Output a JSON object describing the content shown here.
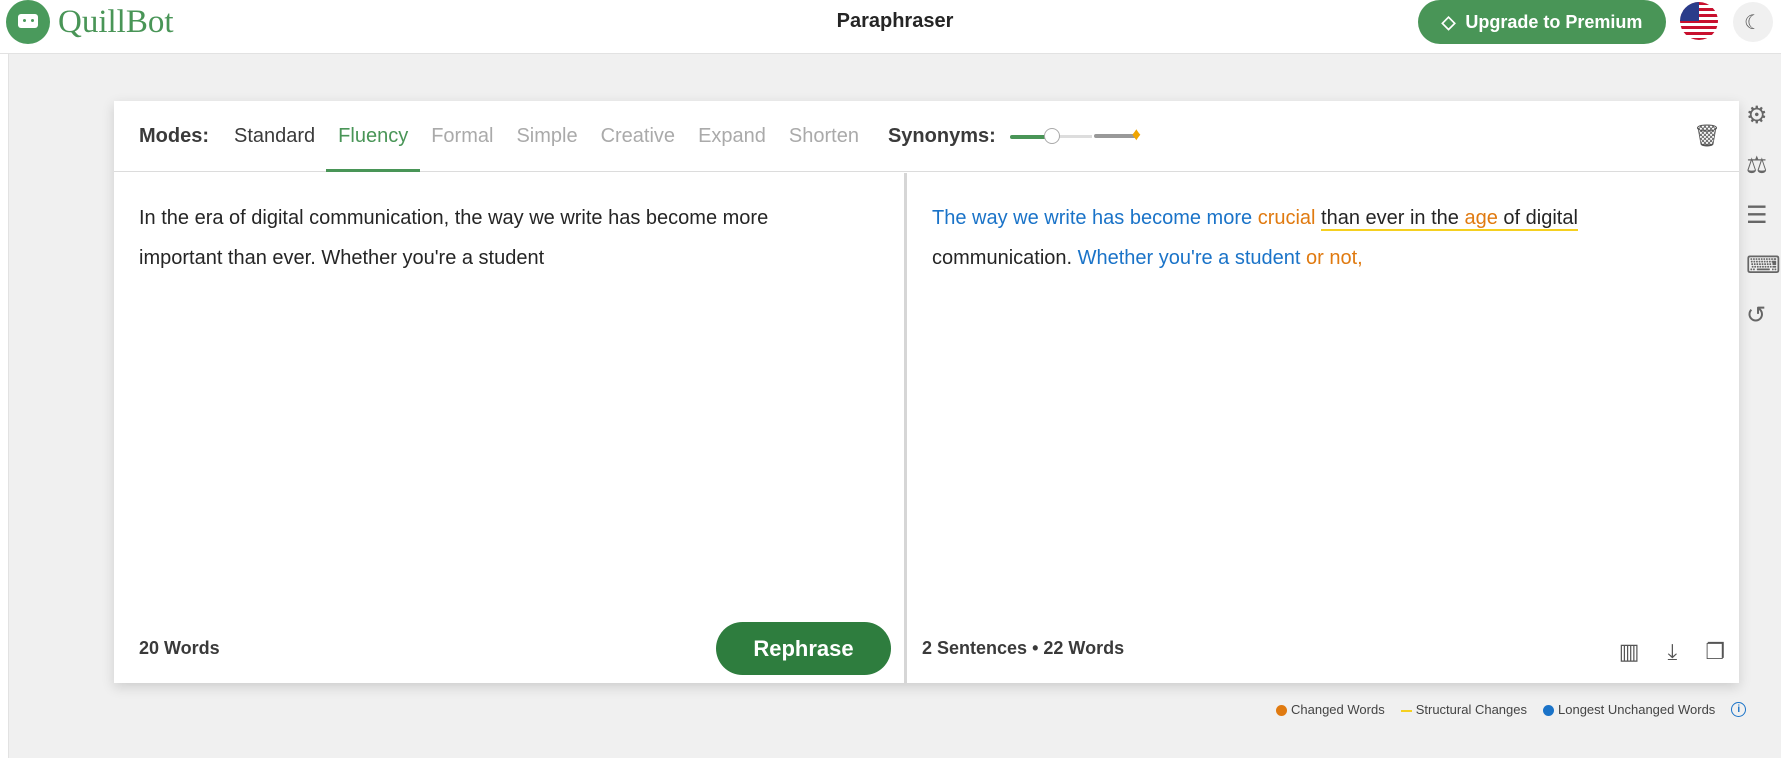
{
  "header": {
    "brand": "QuillBot",
    "title": "Paraphraser",
    "upgrade_label": "Upgrade to Premium",
    "upgrade_icon": "diamond-icon",
    "language_icon": "us-flag-icon",
    "theme_icon": "moon-icon"
  },
  "modes": {
    "label": "Modes:",
    "items": [
      "Standard",
      "Fluency",
      "Formal",
      "Simple",
      "Creative",
      "Expand",
      "Shorten"
    ],
    "active": "Fluency"
  },
  "synonyms": {
    "label": "Synonyms:",
    "level": 0.3,
    "premium_icon": "diamond-icon"
  },
  "input": {
    "text": "In the era of digital communication, the way we write has become more important than ever. Whether you're a student",
    "word_count": "20 Words",
    "rephrase_label": "Rephrase"
  },
  "output": {
    "segments": [
      {
        "text": "The way we write has become more ",
        "type": "unchanged"
      },
      {
        "text": "crucial",
        "type": "changed"
      },
      {
        "text": " ",
        "type": "plain"
      },
      {
        "text": "than ever in the ",
        "type": "structural"
      },
      {
        "text": "age",
        "type": "structural-changed"
      },
      {
        "text": " of digital",
        "type": "structural"
      },
      {
        "text": " communication. ",
        "type": "plain"
      },
      {
        "text": "Whether you're a student",
        "type": "unchanged"
      },
      {
        "text": " or not,",
        "type": "changed"
      }
    ],
    "sentences": "2 Sentences",
    "separator": "•",
    "words": "22 Words"
  },
  "legend": {
    "changed": "Changed Words",
    "structural": "Structural Changes",
    "unchanged": "Longest Unchanged Words",
    "colors": {
      "changed": "#e07a10",
      "structural": "#f5d020",
      "unchanged": "#1a73c8"
    }
  },
  "side_tools": [
    "gear-icon",
    "compare-modes-icon",
    "comments-icon",
    "keyboard-icon",
    "history-icon"
  ]
}
